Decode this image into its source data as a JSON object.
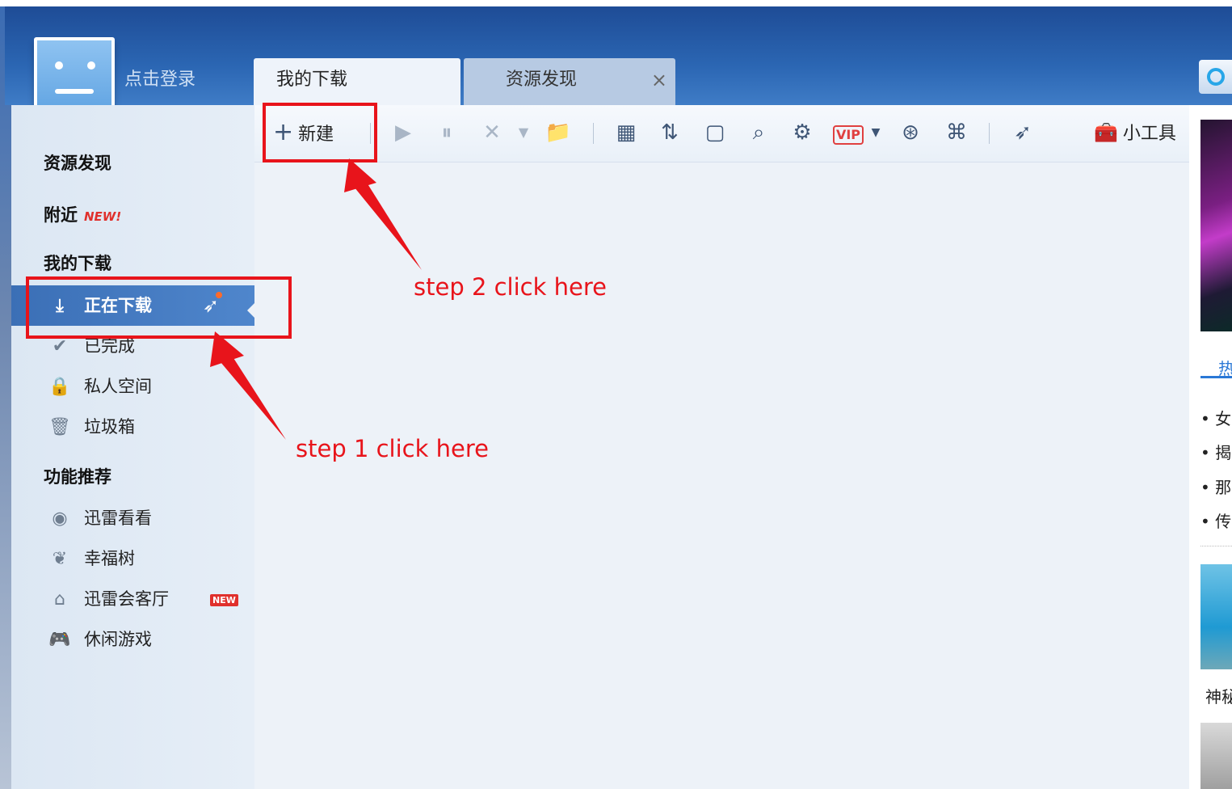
{
  "user": {
    "login_label": "点击登录"
  },
  "tabs": [
    {
      "label": "我的下载"
    },
    {
      "label": "资源发现",
      "close": "×"
    }
  ],
  "toolbar": {
    "new_label": "新建",
    "tools_label": "小工具",
    "vip_label": "VIP"
  },
  "sidebar": {
    "discover": "资源发现",
    "nearby": "附近",
    "nearby_badge": "NEW!",
    "my_downloads": "我的下载",
    "items": [
      {
        "label": "正在下载"
      },
      {
        "label": "已完成"
      },
      {
        "label": "私人空间"
      },
      {
        "label": "垃圾箱"
      }
    ],
    "features_title": "功能推荐",
    "features": [
      {
        "label": "迅雷看看"
      },
      {
        "label": "幸福树"
      },
      {
        "label": "迅雷会客厅",
        "badge": "NEW"
      },
      {
        "label": "休闲游戏"
      }
    ]
  },
  "right_panel": {
    "hot_tab": "热",
    "news": [
      "• 女",
      "• 揭",
      "• 那",
      "• 传"
    ],
    "caption": "神秘"
  },
  "annotations": {
    "step1": "step 1 click here",
    "step2": "step 2 click here"
  },
  "colors": {
    "annotation": "#e8141b",
    "header": "#2b66b3",
    "active_item": "#4a7fc6"
  }
}
